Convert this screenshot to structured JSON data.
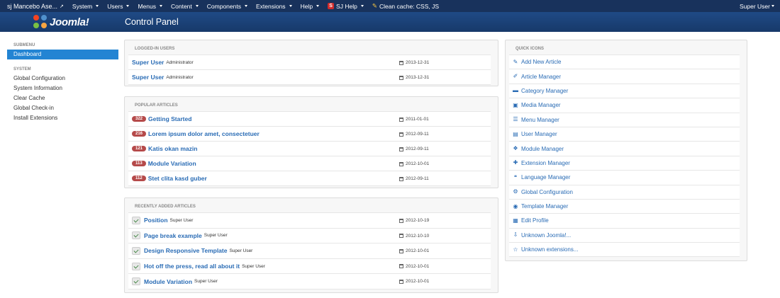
{
  "topnav": {
    "site_name": "sj Mancebo Ase...",
    "menus": [
      "System",
      "Users",
      "Menus",
      "Content",
      "Components",
      "Extensions",
      "Help"
    ],
    "sj_help": "SJ Help",
    "clean_cache": "Clean cache: CSS, JS",
    "user": "Super User"
  },
  "header": {
    "logo_text": "Joomla!",
    "page_title": "Control Panel"
  },
  "sidebar": {
    "submenu_head": "SUBMENU",
    "active_item": "Dashboard",
    "system_head": "SYSTEM",
    "items": [
      "Global Configuration",
      "System Information",
      "Clear Cache",
      "Global Check-in",
      "Install Extensions"
    ]
  },
  "logged_in": {
    "heading": "LOGGED-IN USERS",
    "rows": [
      {
        "name": "Super User",
        "role": "Administrator",
        "date": "2013-12-31"
      },
      {
        "name": "Super User",
        "role": "Administrator",
        "date": "2013-12-31"
      }
    ]
  },
  "popular": {
    "heading": "POPULAR ARTICLES",
    "rows": [
      {
        "hits": "322",
        "title": "Getting Started",
        "date": "2011-01-01"
      },
      {
        "hits": "216",
        "title": "Lorem ipsum dolor amet, consectetuer",
        "date": "2012-09-11"
      },
      {
        "hits": "121",
        "title": "Katis okan mazin",
        "date": "2012-09-11"
      },
      {
        "hits": "113",
        "title": "Module Variation",
        "date": "2012-10-01"
      },
      {
        "hits": "112",
        "title": "Stet clita kasd guber",
        "date": "2012-09-11"
      }
    ]
  },
  "recent": {
    "heading": "RECENTLY ADDED ARTICLES",
    "rows": [
      {
        "title": "Position",
        "author": "Super User",
        "date": "2012-10-19"
      },
      {
        "title": "Page break example",
        "author": "Super User",
        "date": "2012-10-10"
      },
      {
        "title": "Design Responsive Template",
        "author": "Super User",
        "date": "2012-10-01"
      },
      {
        "title": "Hot off the press, read all about it",
        "author": "Super User",
        "date": "2012-10-01"
      },
      {
        "title": "Module Variation",
        "author": "Super User",
        "date": "2012-10-01"
      }
    ]
  },
  "quick_icons": {
    "heading": "QUICK ICONS",
    "items": [
      {
        "label": "Add New Article",
        "icon": "pencil-square-icon",
        "glyph": "✎"
      },
      {
        "label": "Article Manager",
        "icon": "pencil-icon",
        "glyph": "✐"
      },
      {
        "label": "Category Manager",
        "icon": "folder-icon",
        "glyph": "▬"
      },
      {
        "label": "Media Manager",
        "icon": "image-icon",
        "glyph": "▣"
      },
      {
        "label": "Menu Manager",
        "icon": "list-icon",
        "glyph": "☰"
      },
      {
        "label": "User Manager",
        "icon": "user-icon",
        "glyph": "▤"
      },
      {
        "label": "Module Manager",
        "icon": "cube-icon",
        "glyph": "❖"
      },
      {
        "label": "Extension Manager",
        "icon": "puzzle-icon",
        "glyph": "✚"
      },
      {
        "label": "Language Manager",
        "icon": "comments-icon",
        "glyph": "❝"
      },
      {
        "label": "Global Configuration",
        "icon": "cog-icon",
        "glyph": "⚙"
      },
      {
        "label": "Template Manager",
        "icon": "eye-icon",
        "glyph": "◉"
      },
      {
        "label": "Edit Profile",
        "icon": "profile-icon",
        "glyph": "▦"
      },
      {
        "label": "Unknown Joomla!...",
        "icon": "download-icon",
        "glyph": "⇩"
      },
      {
        "label": "Unknown extensions...",
        "icon": "star-icon",
        "glyph": "☆"
      }
    ]
  }
}
